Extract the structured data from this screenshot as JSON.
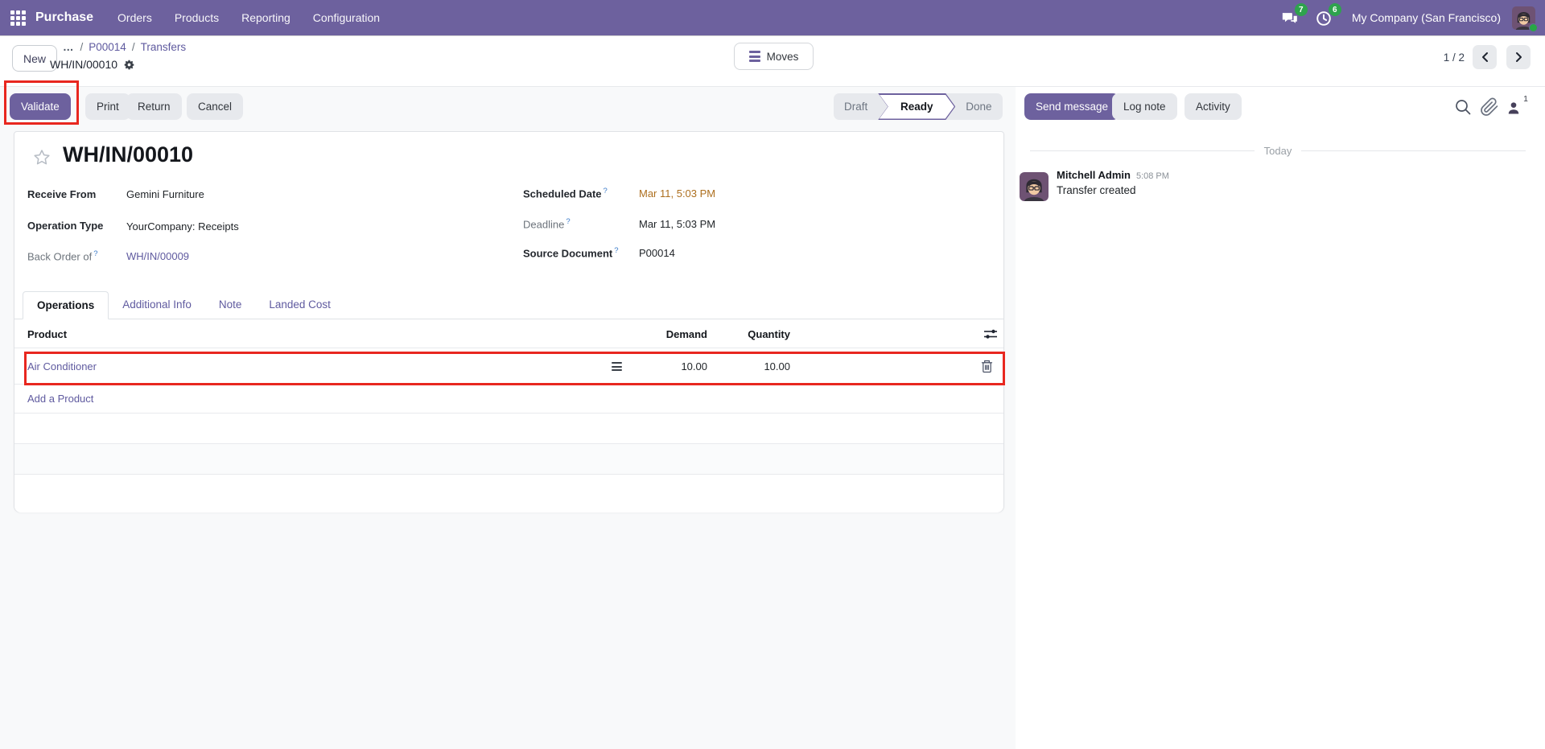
{
  "colors": {
    "accent": "#6d619e",
    "link": "#5f5a9f",
    "scheduled_date_warning": "#ad6f1f",
    "badge_green": "#2ea34d",
    "annotation_red": "#e8271f",
    "secondary_button": "#e7e9ed"
  },
  "topbar": {
    "app_name": "Purchase",
    "menus": [
      "Orders",
      "Products",
      "Reporting",
      "Configuration"
    ],
    "messages_badge": "7",
    "activities_badge": "6",
    "company": "My Company (San Francisco)"
  },
  "control_panel": {
    "new_button": "New",
    "breadcrumb_ellipsis": "…",
    "breadcrumb_sep": "/",
    "breadcrumb_items": [
      "P00014",
      "Transfers"
    ],
    "record_name": "WH/IN/00010",
    "moves_button": "Moves",
    "pager": "1 / 2"
  },
  "action_bar": {
    "validate": "Validate",
    "print": "Print",
    "return": "Return",
    "cancel": "Cancel"
  },
  "statusbar": {
    "steps": [
      "Draft",
      "Ready",
      "Done"
    ],
    "active": "Ready"
  },
  "sheet": {
    "title": "WH/IN/00010",
    "fields": {
      "receive_from": {
        "label": "Receive From",
        "value": "Gemini Furniture"
      },
      "operation_type": {
        "label": "Operation Type",
        "value": "YourCompany: Receipts"
      },
      "back_order_of": {
        "label": "Back Order of",
        "help": "?",
        "value": "WH/IN/00009"
      },
      "scheduled_date": {
        "label": "Scheduled Date",
        "help": "?",
        "value": "Mar 11, 5:03 PM"
      },
      "deadline": {
        "label": "Deadline",
        "help": "?",
        "value": "Mar 11, 5:03 PM"
      },
      "source_document": {
        "label": "Source Document",
        "help": "?",
        "value": "P00014"
      }
    },
    "tabs": [
      "Operations",
      "Additional Info",
      "Note",
      "Landed Cost"
    ],
    "active_tab": "Operations",
    "table": {
      "headers": {
        "product": "Product",
        "demand": "Demand",
        "quantity": "Quantity"
      },
      "rows": [
        {
          "product": "Air Conditioner",
          "demand": "10.00",
          "quantity": "10.00"
        }
      ],
      "add_line": "Add a Product"
    }
  },
  "chatter": {
    "send_message": "Send message",
    "log_note": "Log note",
    "activity": "Activity",
    "followers_count": "1",
    "date_separator": "Today",
    "messages": [
      {
        "author": "Mitchell Admin",
        "time": "5:08 PM",
        "body": "Transfer created"
      }
    ]
  }
}
